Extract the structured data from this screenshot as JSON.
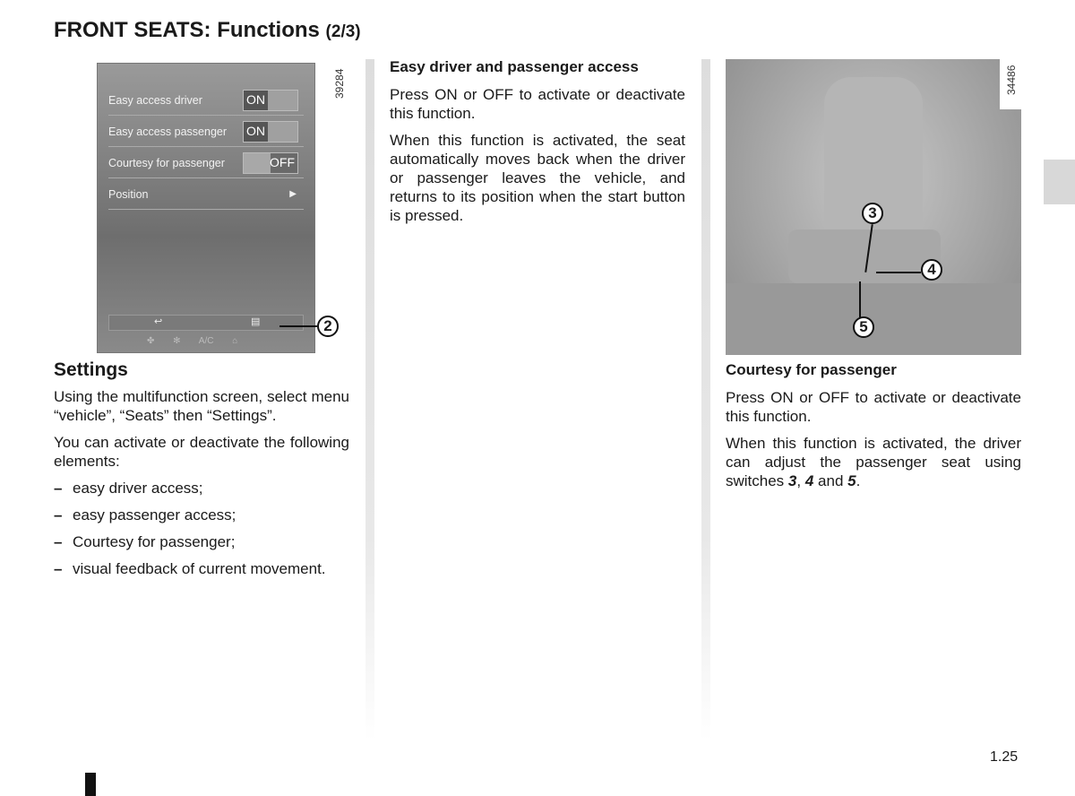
{
  "header": {
    "title": "FRONT SEATS: Functions",
    "part": "(2/3)"
  },
  "figure1": {
    "code": "39284",
    "rows": [
      {
        "label": "Easy access driver",
        "toggle": "ON"
      },
      {
        "label": "Easy access passenger",
        "toggle": "ON"
      },
      {
        "label": "Courtesy for passenger",
        "toggle": "OFF"
      },
      {
        "label": "Position"
      }
    ],
    "bottom_icons": [
      "back-icon",
      "menu-list-icon"
    ],
    "climate_icons": [
      "fan-icon",
      "air-flow-icon",
      "ac-label",
      "defrost-icon"
    ],
    "ac_label": "A/C",
    "callout": "2"
  },
  "left": {
    "heading": "Settings",
    "p1": "Using the multifunction screen, select menu “vehicle”, “Seats” then “Settings”.",
    "p2": "You can activate or deactivate the following elements:",
    "items": [
      "easy driver access;",
      "easy passenger access;",
      "Courtesy for passenger;",
      "visual feedback of current movement."
    ]
  },
  "middle": {
    "heading": "Easy driver and passenger access",
    "p1": "Press ON or OFF to activate or deactivate this function.",
    "p2": "When this function is activated, the seat automatically moves back when the driver or passenger leaves the vehicle, and returns to its position when the start button is pressed."
  },
  "figure2": {
    "code": "34486",
    "callouts": [
      "3",
      "4",
      "5"
    ]
  },
  "right": {
    "heading": "Courtesy for passenger",
    "p1": "Press ON or OFF to activate or deactivate this function.",
    "p2a": "When this function is activated, the driver can adjust the passenger seat using switches ",
    "s3": "3",
    "sep1": ", ",
    "s4": "4",
    "sep2": " and ",
    "s5": "5",
    "end": "."
  },
  "footer": {
    "page": "1.25"
  }
}
